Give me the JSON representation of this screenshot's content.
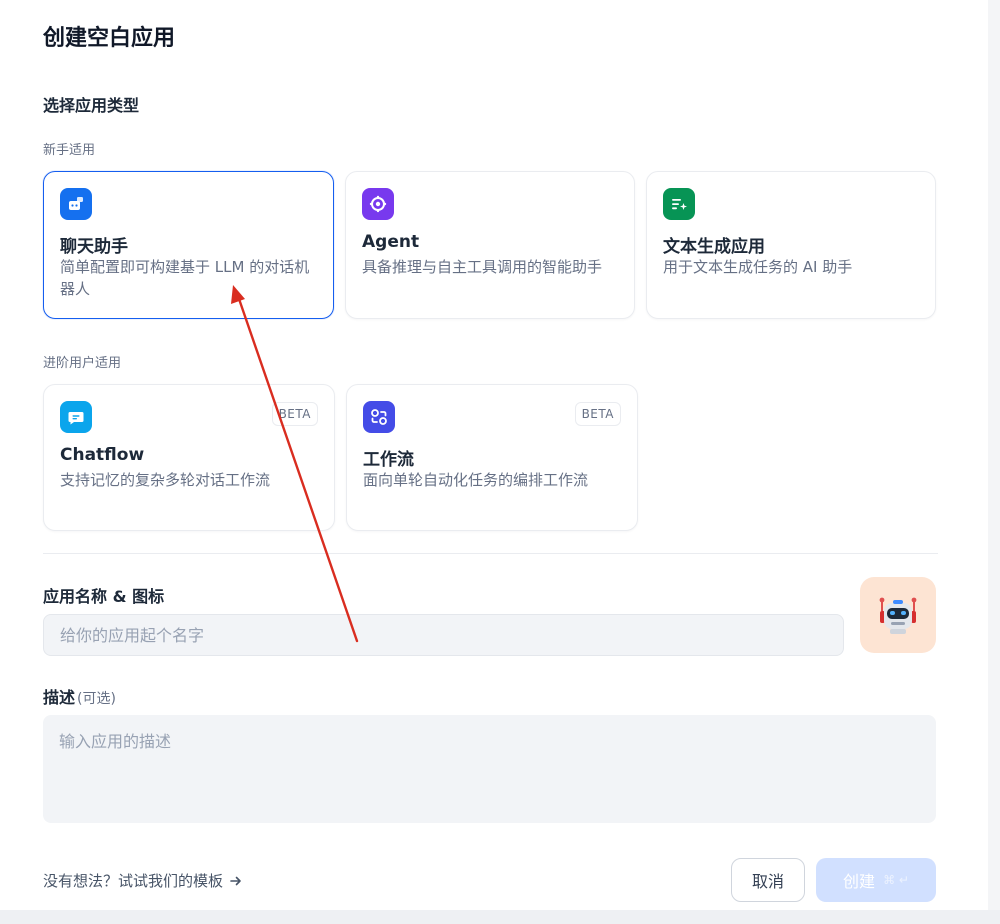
{
  "dialog": {
    "title": "创建空白应用",
    "type_section_label": "选择应用类型",
    "beginner_label": "新手适用",
    "advanced_label": "进阶用户适用"
  },
  "app_types": {
    "beginner": [
      {
        "name": "聊天助手",
        "desc": "简单配置即可构建基于 LLM 的对话机器人",
        "icon": "chat-bot-icon",
        "color": "#1570ef",
        "selected": true
      },
      {
        "name": "Agent",
        "desc": "具备推理与自主工具调用的智能助手",
        "icon": "agent-icon",
        "color": "#7839ee",
        "selected": false
      },
      {
        "name": "文本生成应用",
        "desc": "用于文本生成任务的 AI 助手",
        "icon": "text-generation-icon",
        "color": "#079455",
        "selected": false
      }
    ],
    "advanced": [
      {
        "name": "Chatflow",
        "desc": "支持记忆的复杂多轮对话工作流",
        "badge": "BETA",
        "icon": "chatflow-icon",
        "color": "#0ba5ec"
      },
      {
        "name": "工作流",
        "desc": "面向单轮自动化任务的编排工作流",
        "badge": "BETA",
        "icon": "workflow-icon",
        "color": "#444ce7"
      }
    ]
  },
  "form": {
    "name_label": "应用名称 & 图标",
    "name_placeholder": "给你的应用起个名字",
    "name_value": "",
    "avatar_icon": "robot-icon",
    "avatar_bg": "#fde4d3",
    "desc_label": "描述",
    "desc_optional": "(可选)",
    "desc_placeholder": "输入应用的描述",
    "desc_value": ""
  },
  "footer": {
    "template_link": "没有想法？试试我们的模板",
    "cancel_label": "取消",
    "create_label": "创建",
    "create_shortcut": "⌘ ↵"
  },
  "colors": {
    "accent": "#155eef",
    "annotation_arrow": "#d92d20"
  }
}
